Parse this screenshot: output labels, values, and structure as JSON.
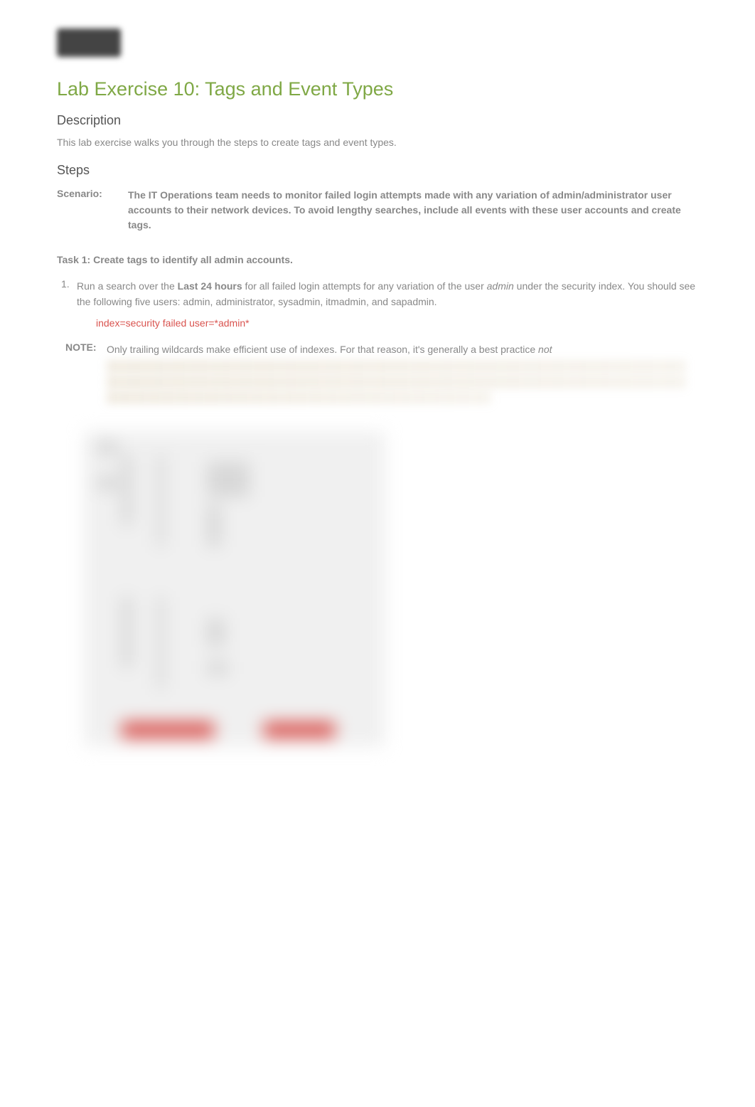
{
  "title": "Lab Exercise 10: Tags and Event Types",
  "description": {
    "heading": "Description",
    "text": "This lab exercise walks you through the steps to create tags and event types."
  },
  "steps": {
    "heading": "Steps"
  },
  "scenario": {
    "label": "Scenario:",
    "text": "The IT Operations team needs to monitor failed login attempts made with any variation of admin/administrator user accounts to their network devices. To avoid lengthy searches, include all events with these user accounts and create tags."
  },
  "task1": {
    "heading": "Task 1: Create tags to identify all admin accounts.",
    "item_number": "1.",
    "item_prefix": "Run a search over the ",
    "item_bold": "Last 24 hours",
    "item_mid": " for all failed login attempts for any variation of the user ",
    "item_italic": "admin",
    "item_suffix": " under the security index. You should see the following five users: admin, administrator, sysadmin, itmadmin, and sapadmin.",
    "code": "index=security failed user=*admin*"
  },
  "note": {
    "label": "NOTE:",
    "text_prefix": "Only trailing wildcards make efficient use of indexes.  For that reason, it's generally a best practice ",
    "text_italic": "not"
  }
}
